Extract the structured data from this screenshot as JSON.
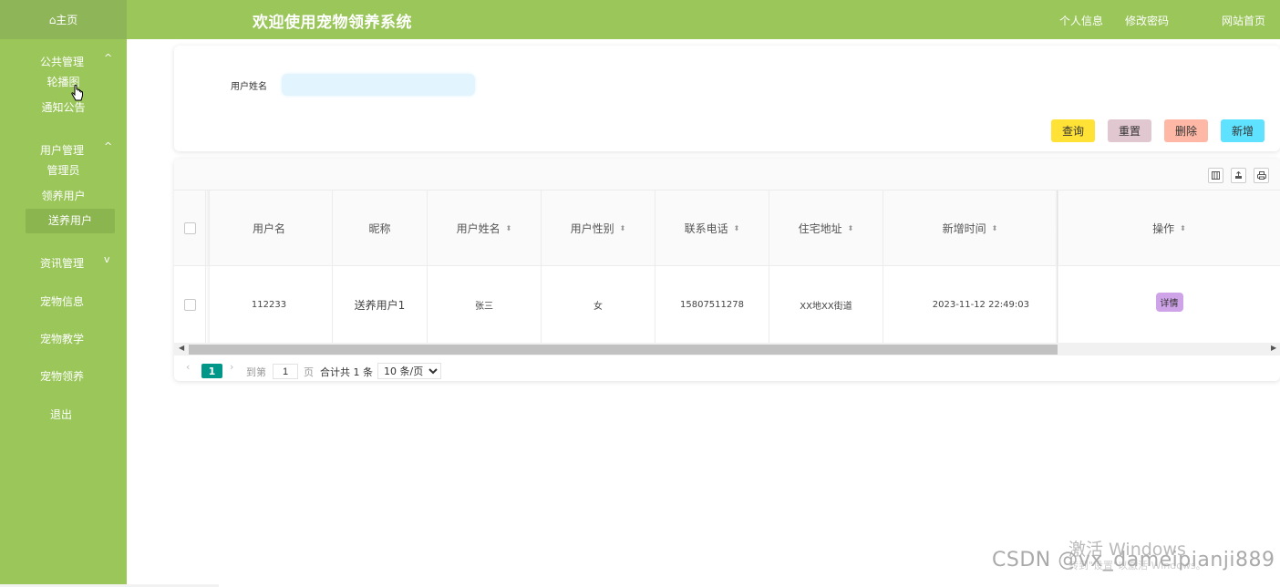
{
  "sidebar": {
    "home_label": "⌂主页",
    "groups": [
      {
        "label": "公共管理",
        "caret": "^",
        "items": [
          "轮播图",
          "通知公告"
        ]
      },
      {
        "label": "用户管理",
        "caret": "^",
        "items": [
          "管理员",
          "领养用户",
          "送养用户"
        ]
      },
      {
        "label": "资讯管理",
        "caret": "v"
      }
    ],
    "items": [
      "宠物信息",
      "宠物教学",
      "宠物领养",
      "退出"
    ],
    "active_item": "送养用户"
  },
  "header": {
    "title": "欢迎使用宠物领养系统",
    "links": [
      "个人信息",
      "修改密码",
      "网站首页"
    ]
  },
  "search": {
    "label": "用户姓名",
    "value": "",
    "placeholder": ""
  },
  "actions": {
    "query": "查询",
    "reset": "重置",
    "delete": "删除",
    "add": "新增"
  },
  "toolbar_icons": [
    "columns-icon",
    "export-icon",
    "print-icon"
  ],
  "table": {
    "columns": [
      "用户名",
      "昵称",
      "用户姓名",
      "用户性别",
      "联系电话",
      "住宅地址",
      "新增时间",
      "操作"
    ],
    "sortable": [
      false,
      false,
      true,
      true,
      true,
      true,
      true,
      true
    ],
    "rows": [
      {
        "username": "112233",
        "nickname": "送养用户1",
        "name": "张三",
        "gender": "女",
        "phone": "15807511278",
        "address": "XX地XX街道",
        "created": "2023-11-12 22:49:03",
        "action": "详情"
      }
    ]
  },
  "pagination": {
    "current_page": "1",
    "goto_label": "到第",
    "goto_value": "1",
    "page_unit": "页",
    "total_text": "合计共 1 条",
    "page_size": "10 条/页"
  },
  "watermarks": {
    "windows": "激活 Windows",
    "windows_sub": "转到\"设置\"以激活 Windows。",
    "csdn": "CSDN @vx_dameipianji889"
  },
  "colors": {
    "theme_green": "#9ac65a",
    "query_btn": "#ffe235",
    "reset_btn": "#e1c8d0",
    "delete_btn": "#ffb8a6",
    "add_btn": "#5ee2ff",
    "detail_badge": "#cfa3e8",
    "page_active": "#009688"
  }
}
